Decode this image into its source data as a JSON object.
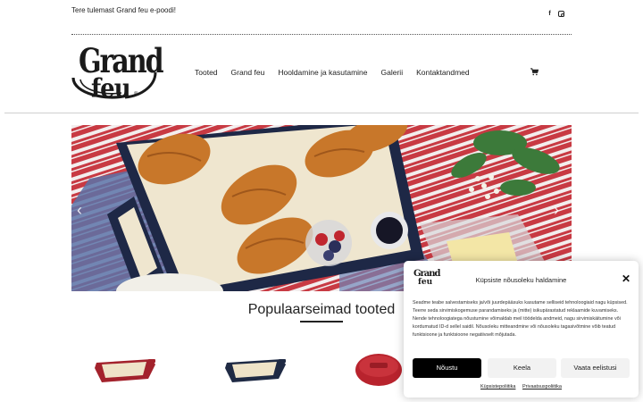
{
  "topbar": {
    "welcome": "Tere tulemast Grand feu e-poodi!",
    "social": [
      {
        "icon": "facebook-icon",
        "glyph": "f"
      },
      {
        "icon": "instagram-icon",
        "glyph": ""
      }
    ]
  },
  "logo": {
    "line1": "Grand",
    "line2": "feu",
    "mark": "®"
  },
  "nav": {
    "items": [
      "Tooted",
      "Grand feu",
      "Hooldamine ja kasutamine",
      "Galerii",
      "Kontaktandmed"
    ],
    "cart_icon": "cart-icon"
  },
  "hero": {
    "prev_glyph": "‹",
    "next_glyph": "›"
  },
  "section": {
    "title": "Populaarseimad tooted"
  },
  "cookie": {
    "logo_line1": "Grand",
    "logo_line2": "feu",
    "title": "Küpsiste nõusoleku haldamine",
    "close_glyph": "✕",
    "text": "Seadme teabe salvestamiseks ja/või juurdepääsuks kasutame selliseid tehnoloogiaid nagu küpsised. Teerre seda sirvimiskogemuse parandamiseks ja (mitte) isikupärastatud reklaamide kuvamiseks. Nende tehnoloogiatega nõustumine võimaldab meil töödelda andmeid, nagu sirvimiskäitumine või kordumatud ID-d sellel saidil. Nõusoleku mitteandmine või nõusoleku tagasivõtmine võib teatud funktsioone ja funktsioone negatiivselt mõjutada.",
    "accept": "Nõustu",
    "deny": "Keela",
    "preferences": "Vaata eelistusi",
    "link_cookie": "Küpsistepoliitika",
    "link_privacy": "Privaatsuspoliitika"
  },
  "colors": {
    "accent": "#000000",
    "product_red": "#a3222c",
    "product_navy": "#1f2a44",
    "tablecloth_red": "#c0363e"
  }
}
